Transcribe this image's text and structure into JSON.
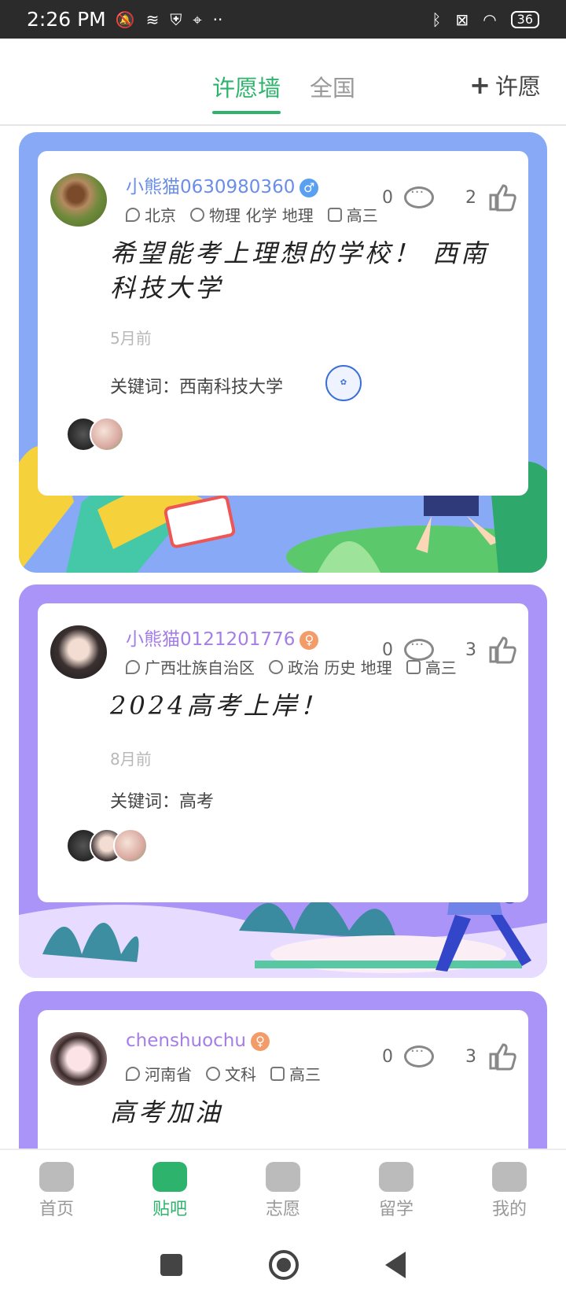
{
  "status": {
    "time": "2:26 PM",
    "battery": "36"
  },
  "header": {
    "tab_wishwall": "许愿墙",
    "tab_national": "全国",
    "wish_button": "许愿"
  },
  "posts": [
    {
      "username": "小熊猫0630980360",
      "gender": "♂",
      "location": "北京",
      "subjects": "物理 化学 地理",
      "grade": "高三",
      "comments": "0",
      "likes": "2",
      "message": "希望能考上理想的学校！ 西南科技大学",
      "time_ago": "5月前",
      "keyword": "关键词：西南科技大学",
      "theme": "#88aaf6"
    },
    {
      "username": "小熊猫0121201776",
      "gender": "♀",
      "location": "广西壮族自治区",
      "subjects": "政治 历史 地理",
      "grade": "高三",
      "comments": "0",
      "likes": "3",
      "message": "2024高考上岸！",
      "time_ago": "8月前",
      "keyword": "关键词：高考",
      "theme": "#ab94f7"
    },
    {
      "username": "chenshuochu",
      "gender": "♀",
      "location": "河南省",
      "subjects": "文科",
      "grade": "高三",
      "comments": "0",
      "likes": "3",
      "message": "高考加油",
      "theme": "#ab94f7"
    }
  ],
  "tabbar": {
    "home": "首页",
    "forum": "贴吧",
    "volunteer": "志愿",
    "study_abroad": "留学",
    "mine": "我的"
  },
  "colors": {
    "accent": "#2db36b"
  }
}
